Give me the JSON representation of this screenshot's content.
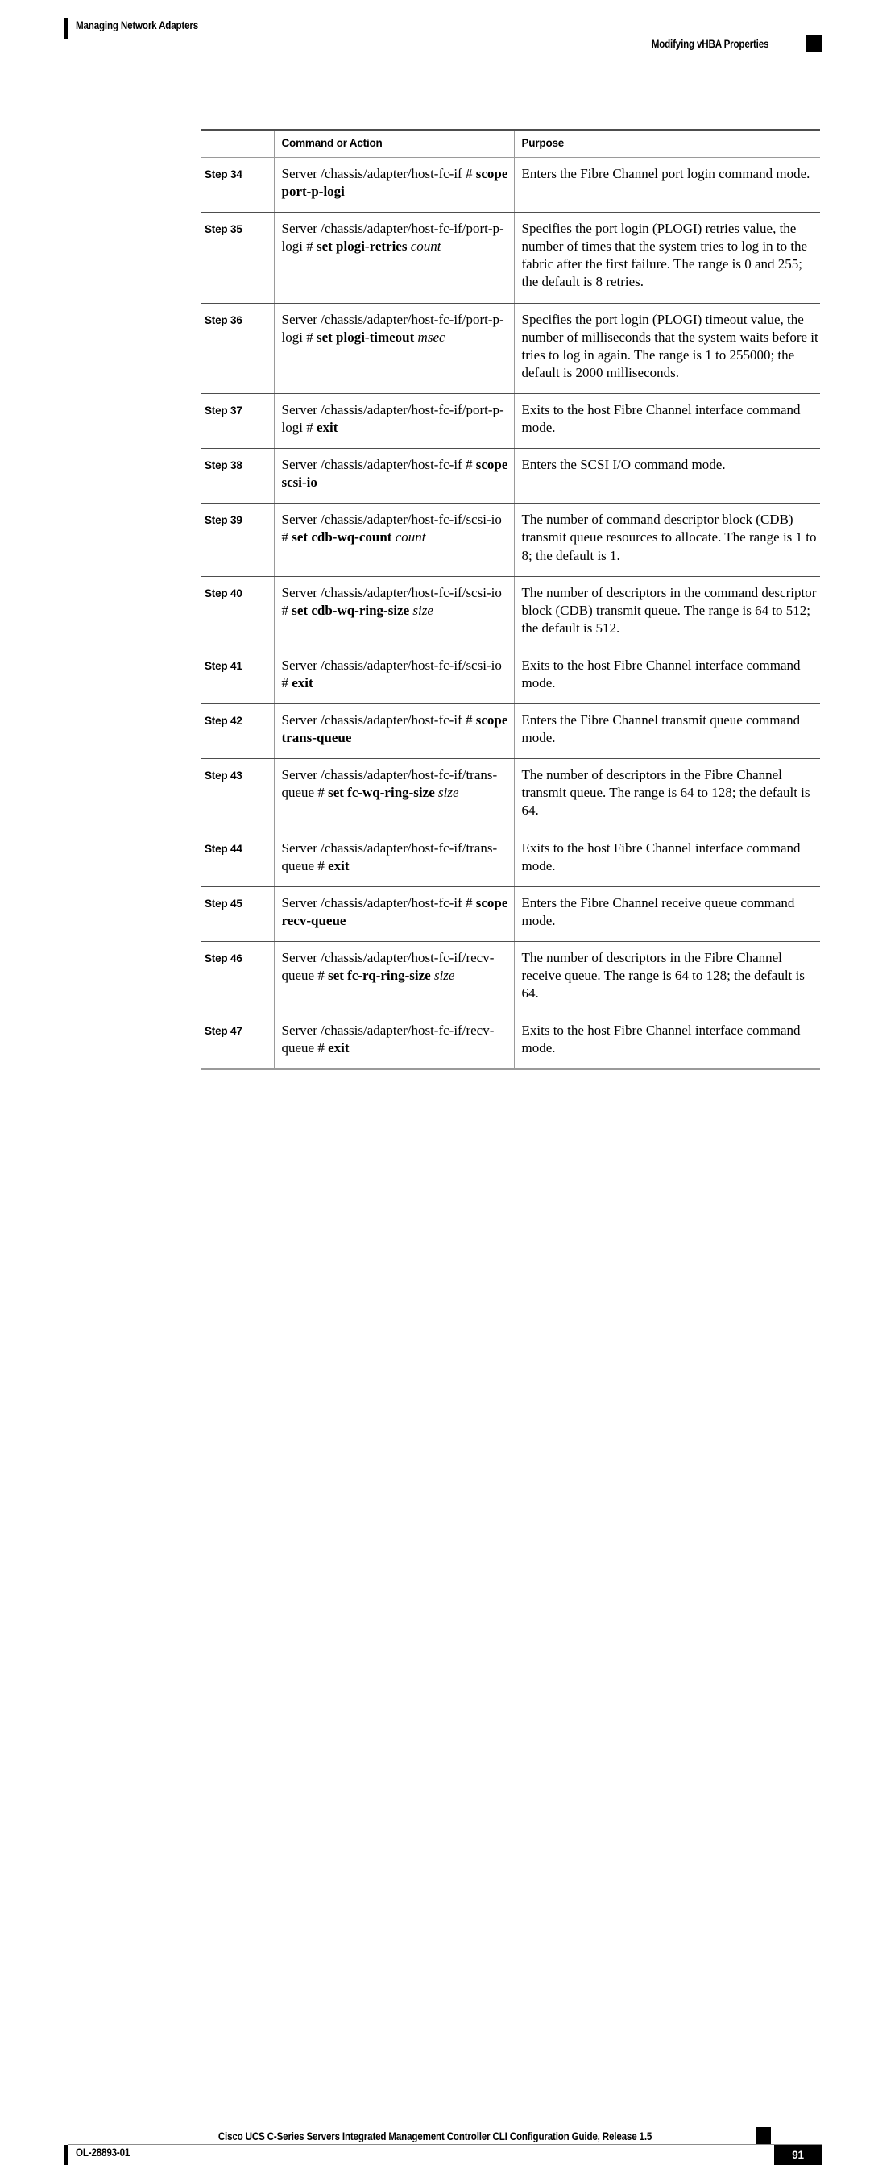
{
  "header": {
    "left_title": "Managing Network Adapters",
    "right_title": "Modifying vHBA Properties"
  },
  "table": {
    "columns": {
      "step": "",
      "command": "Command or Action",
      "purpose": "Purpose"
    },
    "rows": [
      {
        "step": "Step 34",
        "command_parts": [
          {
            "text": "Server /chassis/adapter/host-fc-if # ",
            "style": "normal"
          },
          {
            "text": "scope port-p-logi",
            "style": "bold"
          }
        ],
        "purpose": "Enters the Fibre Channel port login command mode."
      },
      {
        "step": "Step 35",
        "command_parts": [
          {
            "text": "Server /chassis/adapter/host-fc-if/port-p-logi # ",
            "style": "normal"
          },
          {
            "text": "set plogi-retries ",
            "style": "bold"
          },
          {
            "text": "count",
            "style": "italic"
          }
        ],
        "purpose": "Specifies the port login (PLOGI) retries value, the number of times that the system tries to log in to the fabric after the first failure. The range is 0 and 255; the default is 8 retries."
      },
      {
        "step": "Step 36",
        "command_parts": [
          {
            "text": "Server /chassis/adapter/host-fc-if/port-p-logi # ",
            "style": "normal"
          },
          {
            "text": "set plogi-timeout ",
            "style": "bold"
          },
          {
            "text": "msec",
            "style": "italic"
          }
        ],
        "purpose": "Specifies the port login (PLOGI) timeout value, the number of milliseconds that the system waits before it tries to log in again. The range is 1 to 255000; the default is 2000 milliseconds."
      },
      {
        "step": "Step 37",
        "command_parts": [
          {
            "text": "Server /chassis/adapter/host-fc-if/port-p-logi # ",
            "style": "normal"
          },
          {
            "text": "exit",
            "style": "bold"
          }
        ],
        "purpose": "Exits to the host Fibre Channel interface command mode."
      },
      {
        "step": "Step 38",
        "command_parts": [
          {
            "text": "Server /chassis/adapter/host-fc-if # ",
            "style": "normal"
          },
          {
            "text": "scope scsi-io",
            "style": "bold"
          }
        ],
        "purpose": "Enters the SCSI I/O command mode."
      },
      {
        "step": "Step 39",
        "command_parts": [
          {
            "text": "Server /chassis/adapter/host-fc-if/scsi-io # ",
            "style": "normal"
          },
          {
            "text": "set cdb-wq-count ",
            "style": "bold"
          },
          {
            "text": "count",
            "style": "italic"
          }
        ],
        "purpose": "The number of command descriptor block (CDB) transmit queue resources to allocate. The range is 1 to 8; the default is 1."
      },
      {
        "step": "Step 40",
        "command_parts": [
          {
            "text": "Server /chassis/adapter/host-fc-if/scsi-io # ",
            "style": "normal"
          },
          {
            "text": "set cdb-wq-ring-size ",
            "style": "bold"
          },
          {
            "text": "size",
            "style": "italic"
          }
        ],
        "purpose": "The number of descriptors in the command descriptor block (CDB) transmit queue. The range is 64 to 512; the default is 512."
      },
      {
        "step": "Step 41",
        "command_parts": [
          {
            "text": "Server /chassis/adapter/host-fc-if/scsi-io # ",
            "style": "normal"
          },
          {
            "text": "exit",
            "style": "bold"
          }
        ],
        "purpose": "Exits to the host Fibre Channel interface command mode."
      },
      {
        "step": "Step 42",
        "command_parts": [
          {
            "text": "Server /chassis/adapter/host-fc-if # ",
            "style": "normal"
          },
          {
            "text": "scope trans-queue",
            "style": "bold"
          }
        ],
        "purpose": "Enters the Fibre Channel transmit queue command mode."
      },
      {
        "step": "Step 43",
        "command_parts": [
          {
            "text": "Server /chassis/adapter/host-fc-if/trans-queue # ",
            "style": "normal"
          },
          {
            "text": "set fc-wq-ring-size ",
            "style": "bold"
          },
          {
            "text": "size",
            "style": "italic"
          }
        ],
        "purpose": "The number of descriptors in the Fibre Channel transmit queue. The range is 64 to 128; the default is 64."
      },
      {
        "step": "Step 44",
        "command_parts": [
          {
            "text": "Server /chassis/adapter/host-fc-if/trans-queue # ",
            "style": "normal"
          },
          {
            "text": "exit",
            "style": "bold"
          }
        ],
        "purpose": "Exits to the host Fibre Channel interface command mode."
      },
      {
        "step": "Step 45",
        "command_parts": [
          {
            "text": "Server /chassis/adapter/host-fc-if # ",
            "style": "normal"
          },
          {
            "text": "scope recv-queue",
            "style": "bold"
          }
        ],
        "purpose": "Enters the Fibre Channel receive queue command mode."
      },
      {
        "step": "Step 46",
        "command_parts": [
          {
            "text": "Server /chassis/adapter/host-fc-if/recv-queue # ",
            "style": "normal"
          },
          {
            "text": "set fc-rq-ring-size ",
            "style": "bold"
          },
          {
            "text": "size",
            "style": "italic"
          }
        ],
        "purpose": "The number of descriptors in the Fibre Channel receive queue. The range is 64 to 128; the default is 64."
      },
      {
        "step": "Step 47",
        "command_parts": [
          {
            "text": "Server /chassis/adapter/host-fc-if/recv-queue # ",
            "style": "normal"
          },
          {
            "text": "exit",
            "style": "bold"
          }
        ],
        "purpose": "Exits to the host Fibre Channel interface command mode."
      }
    ]
  },
  "footer": {
    "guide_title": "Cisco UCS C-Series Servers Integrated Management Controller CLI Configuration Guide, Release 1.5",
    "doc_number": "OL-28893-01",
    "page_number": "91"
  }
}
